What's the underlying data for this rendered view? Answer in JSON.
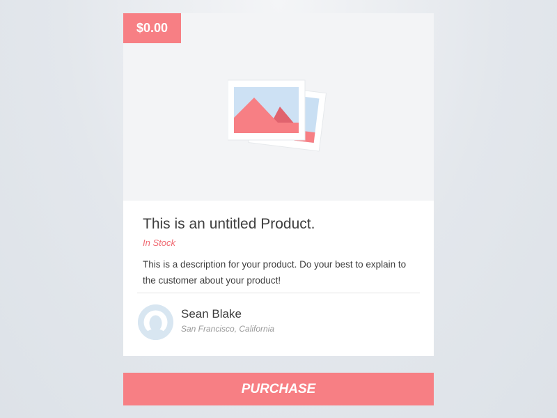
{
  "product": {
    "price": "$0.00",
    "title": "This is an untitled Product.",
    "stock_status": "In Stock",
    "description": "This is a description for your product. Do your best to explain to the customer about your product!",
    "image_icon": "photo-placeholder-icon"
  },
  "author": {
    "name": "Sean Blake",
    "location": "San Francisco, California",
    "avatar_icon": "user-avatar-icon"
  },
  "actions": {
    "purchase_label": "PURCHASE"
  },
  "colors": {
    "accent": "#f77f84",
    "stock_text": "#f06b73",
    "card_background": "#ffffff",
    "media_background": "#f3f4f6",
    "avatar_background": "#d8e6f1"
  }
}
